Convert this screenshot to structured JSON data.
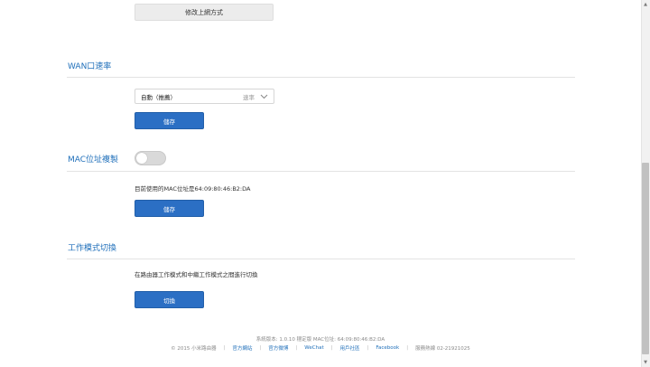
{
  "top_button": {
    "label": "修改上網方式"
  },
  "wan_speed": {
    "title": "WAN口速率",
    "select_value": "自動（推薦）",
    "select_hint": "速率",
    "save_label": "儲存"
  },
  "mac_clone": {
    "title": "MAC位址複製",
    "toggle_on": false,
    "current_mac_text": "目前使用的MAC位址是64:09:80:46:B2:DA",
    "save_label": "儲存"
  },
  "work_mode": {
    "title": "工作模式切換",
    "description": "在路由器工作模式和中繼工作模式之間進行切換",
    "switch_label": "切換"
  },
  "footer": {
    "version_info": "系統版本: 1.0.10 穩定版   MAC位址: 64:09:80:46:B2:DA",
    "copyright": "© 2015 小米路由器",
    "links": [
      "官方網站",
      "官方微博",
      "WeChat",
      "用戶社區",
      "Facebook"
    ],
    "hotline": "服務熱線 02-21921025"
  },
  "colors": {
    "accent": "#1f6fba",
    "button_blue": "#2b6fc4"
  }
}
